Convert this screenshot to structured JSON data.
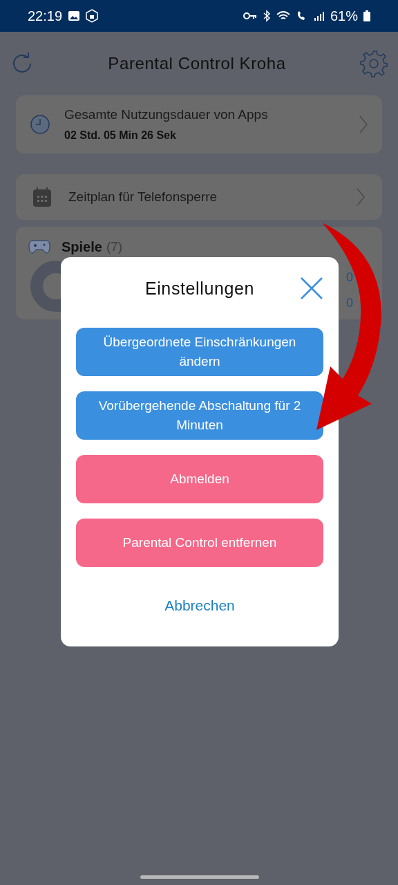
{
  "status_bar": {
    "time": "22:19",
    "battery": "61%"
  },
  "header": {
    "title": "Parental Control Kroha"
  },
  "usage_card": {
    "title": "Gesamte Nutzungsdauer von Apps",
    "duration": "**02** Std. **05** Min **26** Sek"
  },
  "schedule_card": {
    "label": "Zeitplan für Telefonsperre"
  },
  "games_card": {
    "title": "Spiele",
    "count": "(7)",
    "peek_texts": [
      "0",
      "0"
    ]
  },
  "dialog": {
    "title": "Einstellungen",
    "actions": [
      {
        "label": "Übergeordnete Einschränkungen ändern",
        "kind": "primary"
      },
      {
        "label": "Vorübergehende Abschaltung für 2 Minuten",
        "kind": "primary"
      },
      {
        "label": "Abmelden",
        "kind": "danger"
      },
      {
        "label": "Parental Control entfernen",
        "kind": "danger"
      }
    ],
    "cancel": "Abbrechen"
  }
}
